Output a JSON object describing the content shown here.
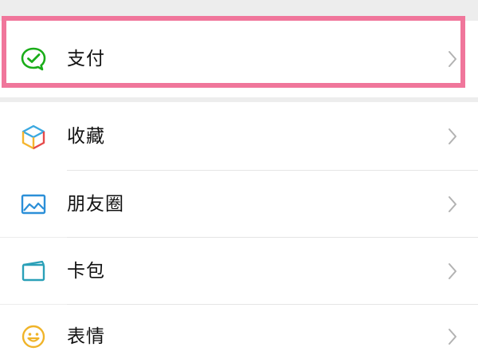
{
  "menu": {
    "items": [
      {
        "label": "支付",
        "icon": "wechat-pay-icon"
      },
      {
        "label": "收藏",
        "icon": "favorites-cube-icon"
      },
      {
        "label": "朋友圈",
        "icon": "moments-picture-icon"
      },
      {
        "label": "卡包",
        "icon": "card-wallet-icon"
      },
      {
        "label": "表情",
        "icon": "smiley-emoji-icon"
      }
    ]
  },
  "colors": {
    "highlight": "#f0769b",
    "pay_green": "#1aad19",
    "background": "#ededed"
  }
}
